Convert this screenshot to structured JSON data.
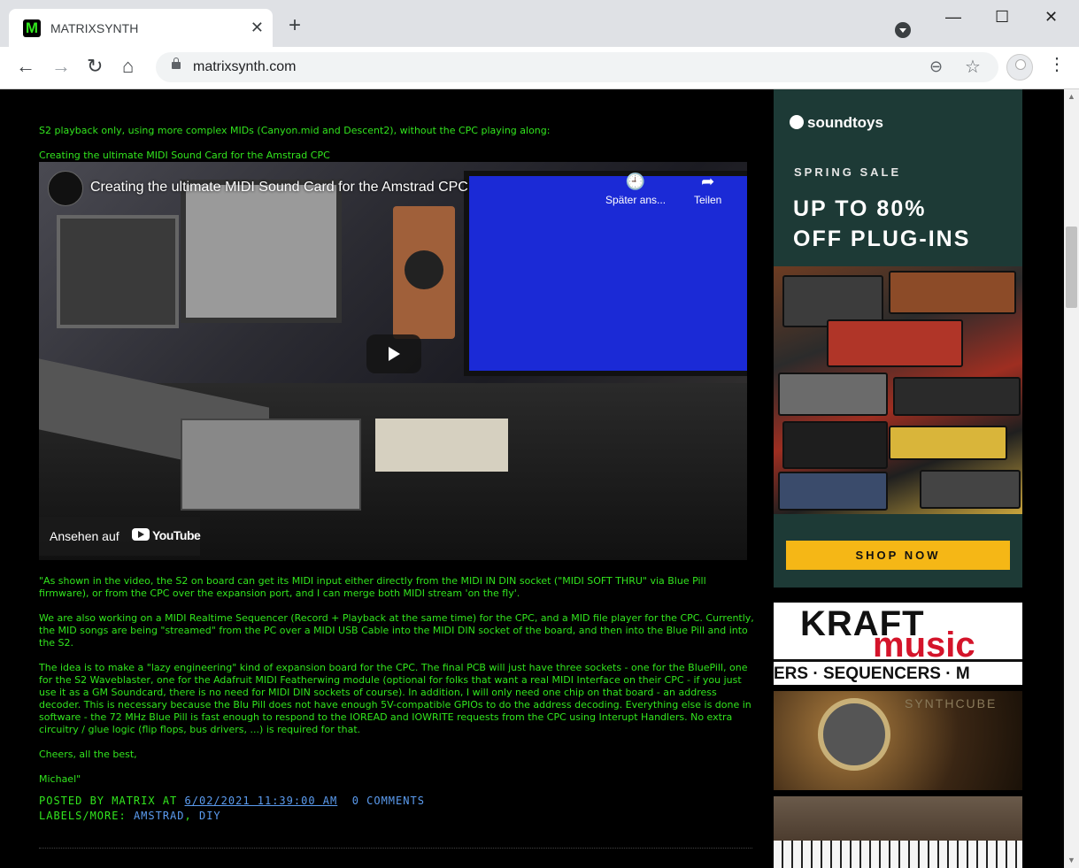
{
  "browser": {
    "tab_title": "MATRIXSYNTH",
    "favicon_letter": "M",
    "new_tab": "+",
    "url": "matrixsynth.com",
    "icons": [
      "back-icon",
      "forward-icon",
      "reload-icon",
      "home-icon",
      "lock-icon",
      "zoom-icon",
      "star-icon",
      "profile-icon",
      "menu-icon"
    ]
  },
  "post": {
    "line1": "S2 playback only, using more complex MIDs (Canyon.mid and Descent2), without the CPC playing along:",
    "line2": "Creating the ultimate MIDI Sound Card for the Amstrad CPC",
    "video": {
      "title": "Creating the ultimate MIDI Sound Card for the Amstrad CPC",
      "watch_later": "Später ans...",
      "share": "Teilen",
      "watch_on": "Ansehen auf",
      "youtube": "YouTube"
    },
    "paragraphs": [
      "\"As shown in the video, the S2 on board can get its MIDI input either directly from the MIDI IN DIN socket (\"MIDI SOFT THRU\" via Blue Pill firmware), or from the CPC over the expansion port, and I can merge both MIDI stream 'on the fly'.",
      "We are also working on a MIDI Realtime Sequencer (Record + Playback at the same time) for the CPC, and a MID file player for the CPC. Currently, the MID songs are being \"streamed\" from the PC over a MIDI USB Cable into the MIDI DIN socket of the board, and then into the Blue Pill and into the S2.",
      "The idea is to make a \"lazy engineering\" kind of expansion board for the CPC. The final PCB will just have three sockets - one for the BluePill, one for the S2 Waveblaster, one for the Adafruit MIDI Featherwing module (optional for folks that want a real MIDI Interface on their CPC - if you just use it as a GM Soundcard, there is no need for MIDI DIN sockets of course). In addition, I will only need one chip on that board - an address decoder. This is necessary because the Blu Pill does not have enough 5V-compatible GPIOs to do the address decoding. Everything else is done in software - the 72 MHz Blue Pill is fast enough to respond to the IOREAD and IOWRITE requests from the CPC using Interupt Handlers. No extra circuitry / glue logic (flip flops, bus drivers, ...) is required for that.",
      "Cheers, all the best,",
      "Michael\""
    ],
    "footer": {
      "posted_by": "POSTED BY MATRIX AT",
      "timestamp": "6/02/2021 11:39:00 AM",
      "comments": "0 COMMENTS",
      "labels_prefix": "LABELS/MORE:",
      "label1": "AMSTRAD",
      "label_sep": ",",
      "label2": "DIY"
    }
  },
  "ads": {
    "soundtoys": {
      "brand": "soundtoys",
      "sale": "SPRING SALE",
      "headline1": "UP TO 80%",
      "headline2": "OFF PLUG-INS",
      "cta": "SHOP NOW"
    },
    "kraft": {
      "brand": "KRAFT",
      "brand2": "music",
      "strip": "ERS · SEQUENCERS · M"
    },
    "synthcube": {
      "brand": "SYNTHCUBE"
    }
  },
  "colors": {
    "post_text": "#32e61e",
    "link": "#5b9cf0",
    "cta_yellow": "#f5b716",
    "kraft_red": "#d4142a"
  }
}
